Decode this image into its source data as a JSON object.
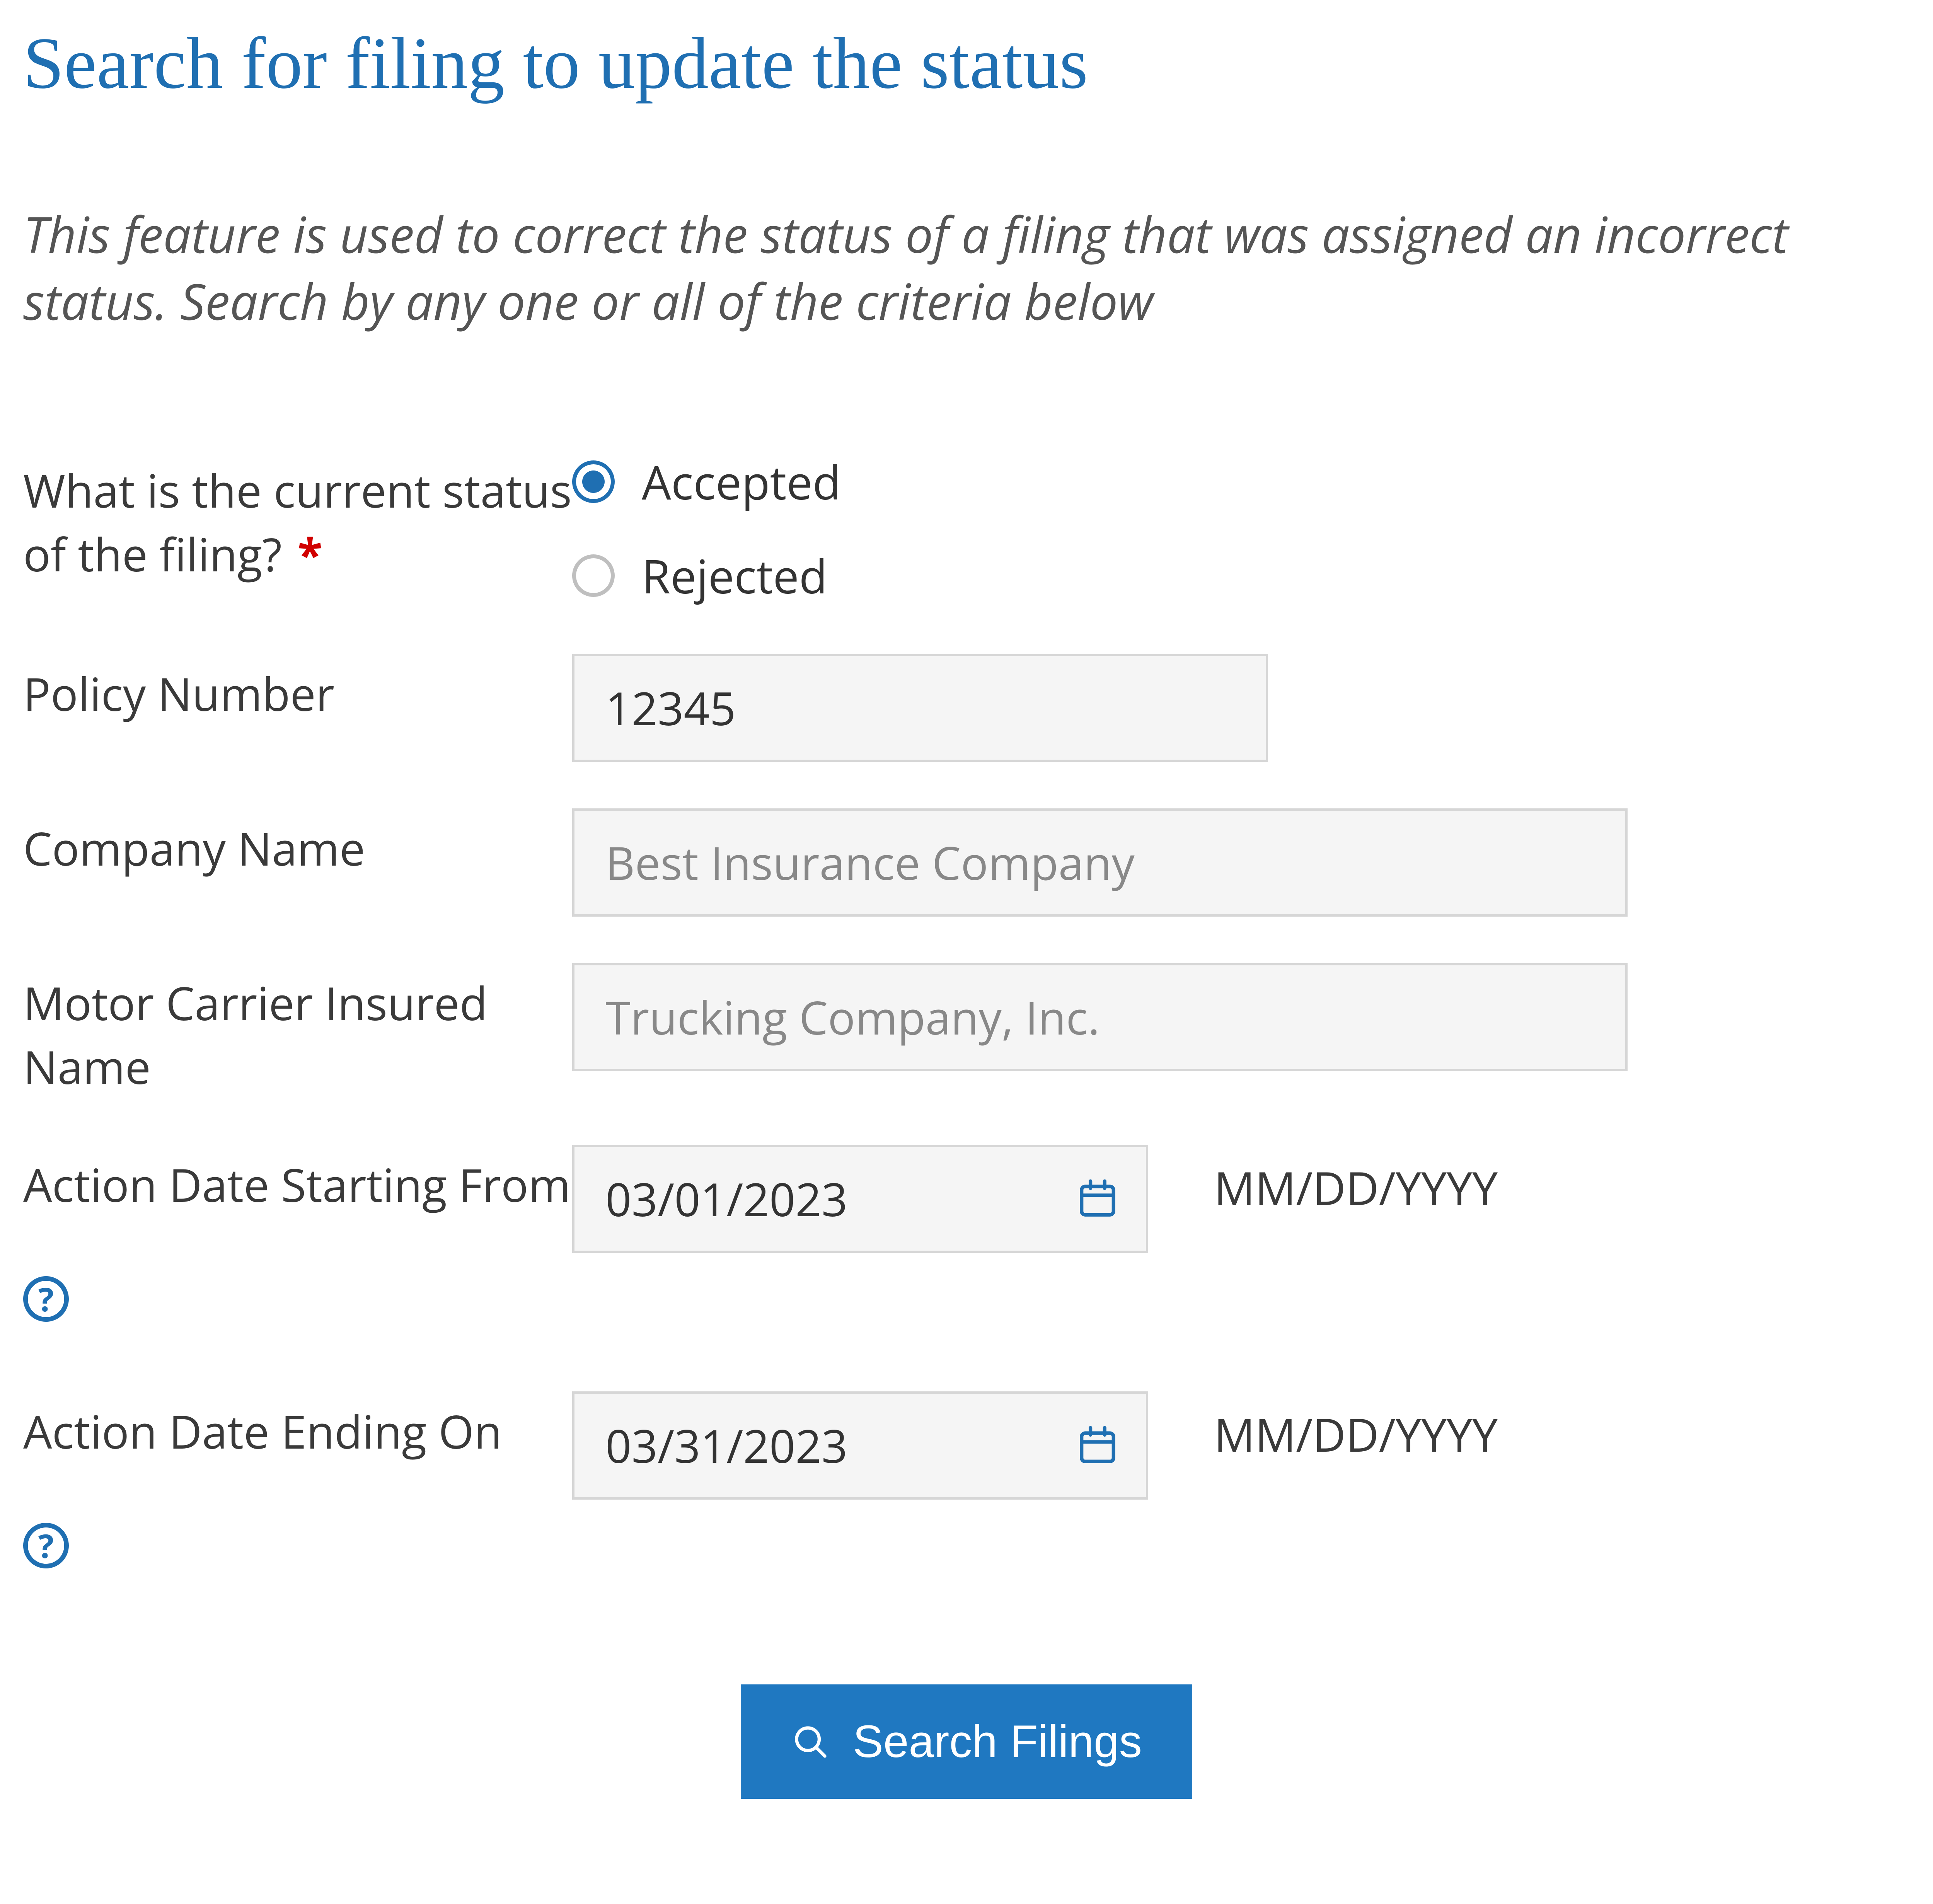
{
  "header": {
    "title": "Search for filing to update the status",
    "description": "This feature is used to correct the status of a filing that was assigned an incorrect status. Search by any one or all of the criteria below"
  },
  "form": {
    "status": {
      "label": "What is the current status of the filing?",
      "required_mark": "*",
      "options": {
        "accepted": "Accepted",
        "rejected": "Rejected"
      },
      "selected": "accepted"
    },
    "policy_number": {
      "label": "Policy Number",
      "value": "12345"
    },
    "company_name": {
      "label": "Company Name",
      "placeholder": "Best Insurance Company",
      "value": ""
    },
    "insured_name": {
      "label": "Motor Carrier Insured Name",
      "placeholder": "Trucking Company, Inc.",
      "value": ""
    },
    "date_from": {
      "label": "Action Date Starting From",
      "value": "03/01/2023",
      "hint": "MM/DD/YYYY"
    },
    "date_to": {
      "label": "Action Date Ending On",
      "value": "03/31/2023",
      "hint": "MM/DD/YYYY"
    },
    "help_glyph": "?"
  },
  "actions": {
    "search_label": "Search Filings"
  },
  "colors": {
    "accent": "#1f78c1",
    "heading": "#1f6fb2",
    "required": "#d10000"
  }
}
